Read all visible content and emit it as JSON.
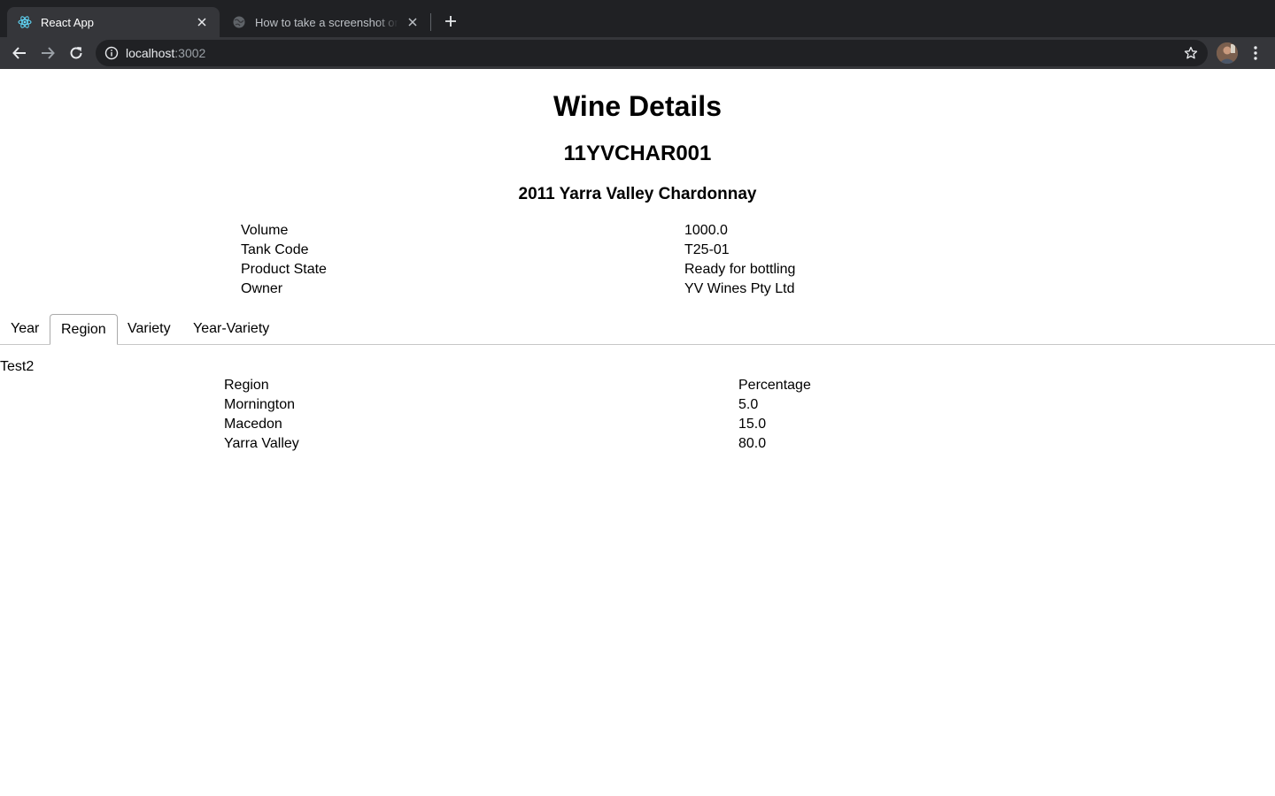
{
  "browser": {
    "tabs": [
      {
        "title": "React App",
        "icon": "react-icon"
      },
      {
        "title": "How to take a screenshot on a Mac - Apple Support",
        "icon": "globe-icon"
      }
    ],
    "address": {
      "host": "localhost",
      "port": ":3002"
    }
  },
  "page": {
    "title": "Wine Details",
    "code": "11YVCHAR001",
    "name": "2011 Yarra Valley Chardonnay",
    "details": [
      {
        "label": "Volume",
        "value": "1000.0"
      },
      {
        "label": "Tank Code",
        "value": "T25-01"
      },
      {
        "label": "Product State",
        "value": "Ready for bottling"
      },
      {
        "label": "Owner",
        "value": "YV Wines Pty Ltd"
      }
    ],
    "tabs": [
      "Year",
      "Region",
      "Variety",
      "Year-Variety"
    ],
    "selected_tab": "Region",
    "panel": {
      "title": "Test2",
      "headers": [
        "Region",
        "Percentage"
      ],
      "rows": [
        [
          "Mornington",
          "5.0"
        ],
        [
          "Macedon",
          "15.0"
        ],
        [
          "Yarra Valley",
          "80.0"
        ]
      ]
    }
  },
  "colors": {
    "chrome_dark": "#202124",
    "chrome_toolbar": "#35363a",
    "react_blue": "#61dafb"
  }
}
